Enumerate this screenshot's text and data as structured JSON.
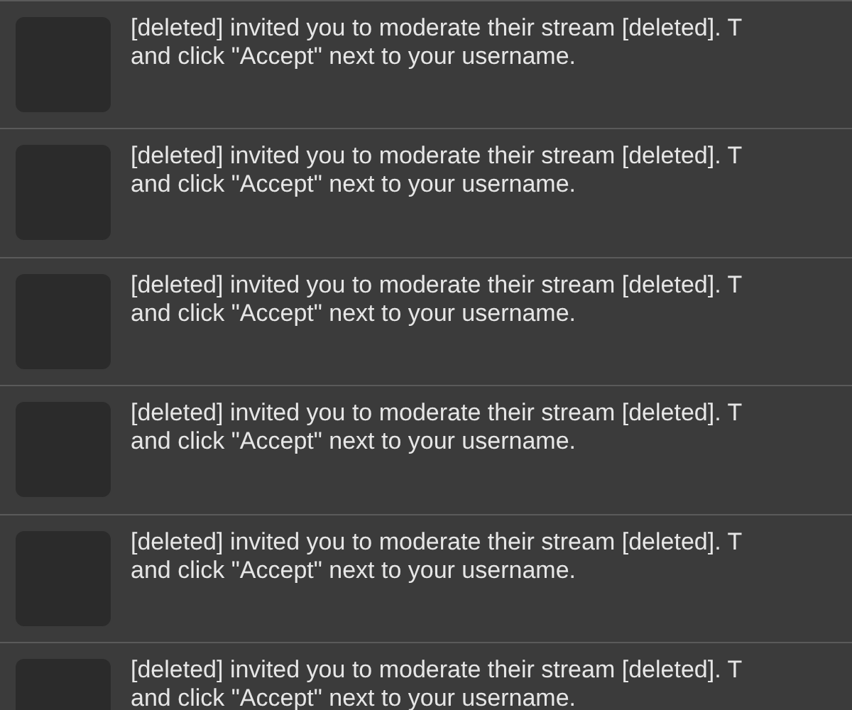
{
  "notifications": [
    {
      "line_1": "[deleted] invited you to moderate their stream [deleted]. T",
      "line_2": "and click \"Accept\" next to your username."
    },
    {
      "line_1": "[deleted] invited you to moderate their stream [deleted]. T",
      "line_2": "and click \"Accept\" next to your username."
    },
    {
      "line_1": "[deleted] invited you to moderate their stream [deleted]. T",
      "line_2": "and click \"Accept\" next to your username."
    },
    {
      "line_1": "[deleted] invited you to moderate their stream [deleted]. T",
      "line_2": "and click \"Accept\" next to your username."
    },
    {
      "line_1": "[deleted] invited you to moderate their stream [deleted]. T",
      "line_2": "and click \"Accept\" next to your username."
    },
    {
      "line_1": "[deleted] invited you to moderate their stream [deleted]. T",
      "line_2": "and click \"Accept\" next to your username."
    }
  ]
}
